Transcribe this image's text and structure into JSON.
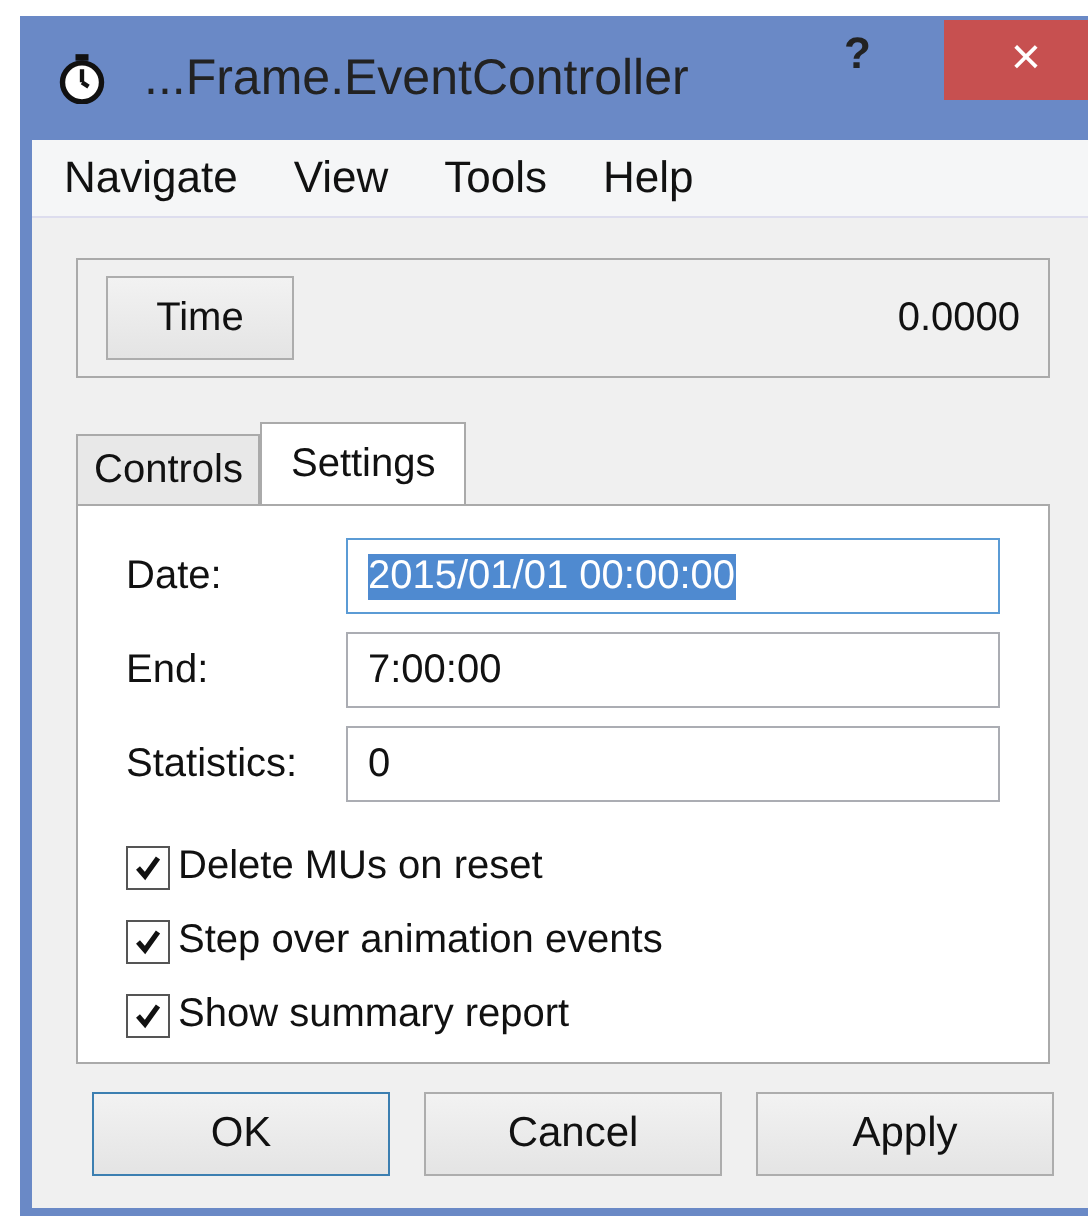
{
  "window": {
    "title": "...Frame.EventController",
    "help": "?",
    "close": "×"
  },
  "menu": [
    "Navigate",
    "View",
    "Tools",
    "Help"
  ],
  "time_panel": {
    "button": "Time",
    "value": "0.0000"
  },
  "tabs": [
    {
      "label": "Controls",
      "selected": false
    },
    {
      "label": "Settings",
      "selected": true
    }
  ],
  "fields": [
    {
      "label": "Date:",
      "value": "2015/01/01 00:00:00",
      "text_selected": true
    },
    {
      "label": "End:",
      "value": "7:00:00",
      "text_selected": false
    },
    {
      "label": "Statistics:",
      "value": "0",
      "text_selected": false
    }
  ],
  "checkboxes": [
    {
      "label": "Delete MUs on reset",
      "checked": true
    },
    {
      "label": "Step over animation events",
      "checked": true
    },
    {
      "label": "Show summary report",
      "checked": true
    }
  ],
  "buttons": [
    {
      "label": "OK",
      "default": true
    },
    {
      "label": "Cancel",
      "default": false
    },
    {
      "label": "Apply",
      "default": false
    }
  ]
}
